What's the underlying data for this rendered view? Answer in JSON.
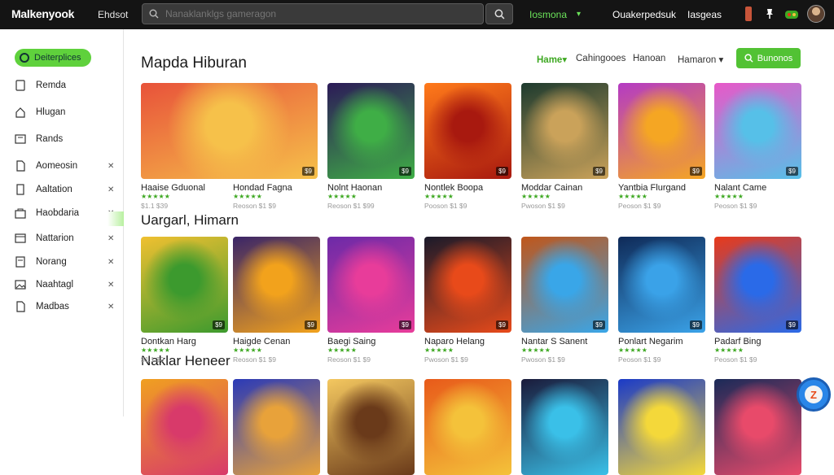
{
  "topbar": {
    "logo": "Malkenyook",
    "link_left": "Ehdsot",
    "search_placeholder": "Nanaklanklgs gameragon",
    "link_green": "Iosmona",
    "link_right_1": "Ouakerpedsuk",
    "link_right_2": "Iasgeas"
  },
  "sidebar": {
    "pill": "Deiterplices",
    "items": [
      {
        "label": "Remda",
        "icon": "user-icon",
        "chevron": ""
      },
      {
        "label": "Hlugan",
        "icon": "home-icon",
        "chevron": ""
      },
      {
        "label": "Rands",
        "icon": "grid-icon",
        "chevron": ""
      },
      {
        "label": "Aomeosin",
        "icon": "file-icon",
        "chevron": "✕"
      },
      {
        "label": "Aaltation",
        "icon": "page-icon",
        "chevron": "✕"
      },
      {
        "label": "Haobdaria",
        "icon": "bag-icon",
        "chevron": "✕"
      },
      {
        "label": "Nattarion",
        "icon": "list-icon",
        "chevron": "✕"
      },
      {
        "label": "Norang",
        "icon": "doc-icon",
        "chevron": "✕"
      },
      {
        "label": "Naahtagl",
        "icon": "image-icon",
        "chevron": "✕"
      },
      {
        "label": "Madbas",
        "icon": "file-icon",
        "chevron": "✕"
      }
    ]
  },
  "main": {
    "title": "Mapda Hiburan",
    "nav": {
      "home": "Hame▾",
      "categories": "Cahingooes",
      "link3": "Hanoan",
      "link4": "Hamaron ▾",
      "button": "Bunonos"
    },
    "sections": [
      {
        "title": "Uargarl, Himarn"
      },
      {
        "title": "Naklar Heneer"
      }
    ],
    "row1": [
      {
        "name": "Haaise Gduonal",
        "stars": "★★★★★",
        "meta": "$1.1 $39",
        "badge": "$9",
        "colors": [
          "#e8523a",
          "#f6c14a"
        ],
        "wide": true
      },
      {
        "name": "Nolnt Haonan",
        "stars": "★★★★★",
        "meta": "Reoson $1 $99",
        "badge": "$9",
        "colors": [
          "#2c1a58",
          "#3fae46"
        ]
      },
      {
        "name": "Nontlek Boopa",
        "stars": "★★★★★",
        "meta": "Pooson $1 $9",
        "badge": "$9",
        "colors": [
          "#ff7a1a",
          "#a8190f"
        ]
      },
      {
        "name": "Moddar Cainan",
        "stars": "★★★★★",
        "meta": "Pwoson $1 $9",
        "badge": "$9",
        "colors": [
          "#1d3a2e",
          "#caa25a"
        ]
      },
      {
        "name": "Yantbia Flurgand",
        "stars": "★★★★★",
        "meta": "Peoson $1 $9",
        "badge": "$9",
        "colors": [
          "#b43ac4",
          "#f5a623"
        ]
      },
      {
        "name": "Nalant Came",
        "stars": "★★★★★",
        "meta": "Peoson $1 $9",
        "badge": "$9",
        "colors": [
          "#e858c8",
          "#56c0e8"
        ]
      }
    ],
    "row1_extra": [
      {
        "name": "Hondad Fagna",
        "stars": "★★★★★",
        "meta": "Reoson $1 $9"
      }
    ],
    "row2": [
      {
        "name": "Dontkan Harg",
        "stars": "★★★★★",
        "meta": "$1.1 $9",
        "badge": "$9",
        "colors": [
          "#f0c030",
          "#3c9a2e"
        ]
      },
      {
        "name": "Haigde Cenan",
        "stars": "★★★★★",
        "meta": "Reoson $1 $9",
        "badge": "$9",
        "colors": [
          "#3a2568",
          "#f2a21c"
        ]
      },
      {
        "name": "Baegi Saing",
        "stars": "★★★★★",
        "meta": "Reoson $1 $9",
        "badge": "$9",
        "colors": [
          "#6c2aa8",
          "#e83c9a"
        ]
      },
      {
        "name": "Naparo Helang",
        "stars": "★★★★★",
        "meta": "Pwoson $1 $9",
        "badge": "$9",
        "colors": [
          "#1a1a2a",
          "#e84a1a"
        ]
      },
      {
        "name": "Nantar S Sanent",
        "stars": "★★★★★",
        "meta": "Pwoson $1 $9",
        "badge": "$9",
        "colors": [
          "#c0561a",
          "#39a6e8"
        ]
      },
      {
        "name": "Ponlart Negarim",
        "stars": "★★★★★",
        "meta": "Peoson $1 $9",
        "badge": "$9",
        "colors": [
          "#0f2a58",
          "#3aa2e8"
        ]
      },
      {
        "name": "Padarf Bing",
        "stars": "★★★★★",
        "meta": "Peoson $1 $9",
        "badge": "$9",
        "colors": [
          "#e83a1a",
          "#2a6ae8"
        ]
      }
    ],
    "row3": [
      {
        "colors": [
          "#f0a020",
          "#d83a6a"
        ]
      },
      {
        "colors": [
          "#2a3ab8",
          "#e8a23a"
        ]
      },
      {
        "colors": [
          "#f4c860",
          "#6a3a1a"
        ]
      },
      {
        "colors": [
          "#e85a1a",
          "#f4c23a"
        ]
      },
      {
        "colors": [
          "#1a1a3a",
          "#3ac0e8"
        ]
      },
      {
        "colors": [
          "#1a3ac8",
          "#f4d83a"
        ]
      },
      {
        "colors": [
          "#1a2a58",
          "#e84a6a"
        ]
      }
    ]
  }
}
